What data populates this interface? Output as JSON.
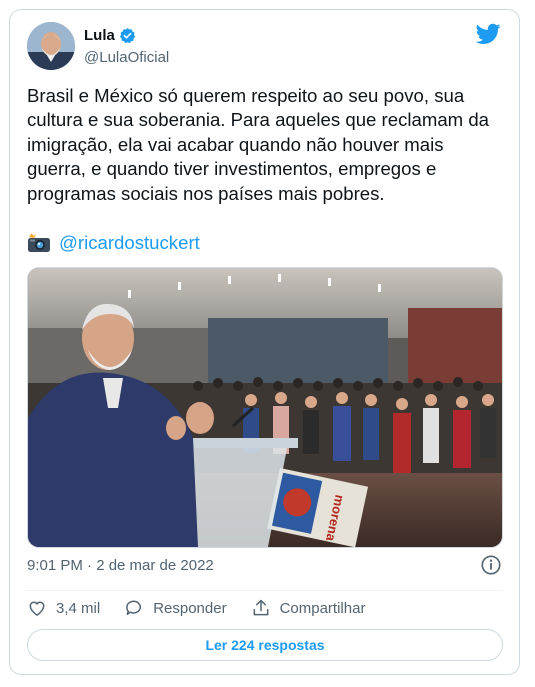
{
  "author": {
    "name": "Lula",
    "handle": "@LulaOficial",
    "verified": true
  },
  "tweet": {
    "text": "Brasil e México só querem respeito ao seu povo, sua cultura e sua soberania. Para aqueles que reclamam da imigração, ela vai acabar quando não houver mais guerra, e quando tiver investimentos, empregos e programas sociais nos países mais pobres.",
    "photo_credit": "@ricardostuckert",
    "timestamp": "9:01 PM · 2 de mar de 2022"
  },
  "actions": {
    "likes": "3,4 mil",
    "reply_label": "Responder",
    "share_label": "Compartilhar"
  },
  "replies_button": "Ler 224 respostas",
  "photo": {
    "banner_text": "morena"
  },
  "colors": {
    "accent": "#1d9bf0",
    "text": "#0f1419",
    "secondary": "#536471",
    "border": "#cfd9de"
  }
}
